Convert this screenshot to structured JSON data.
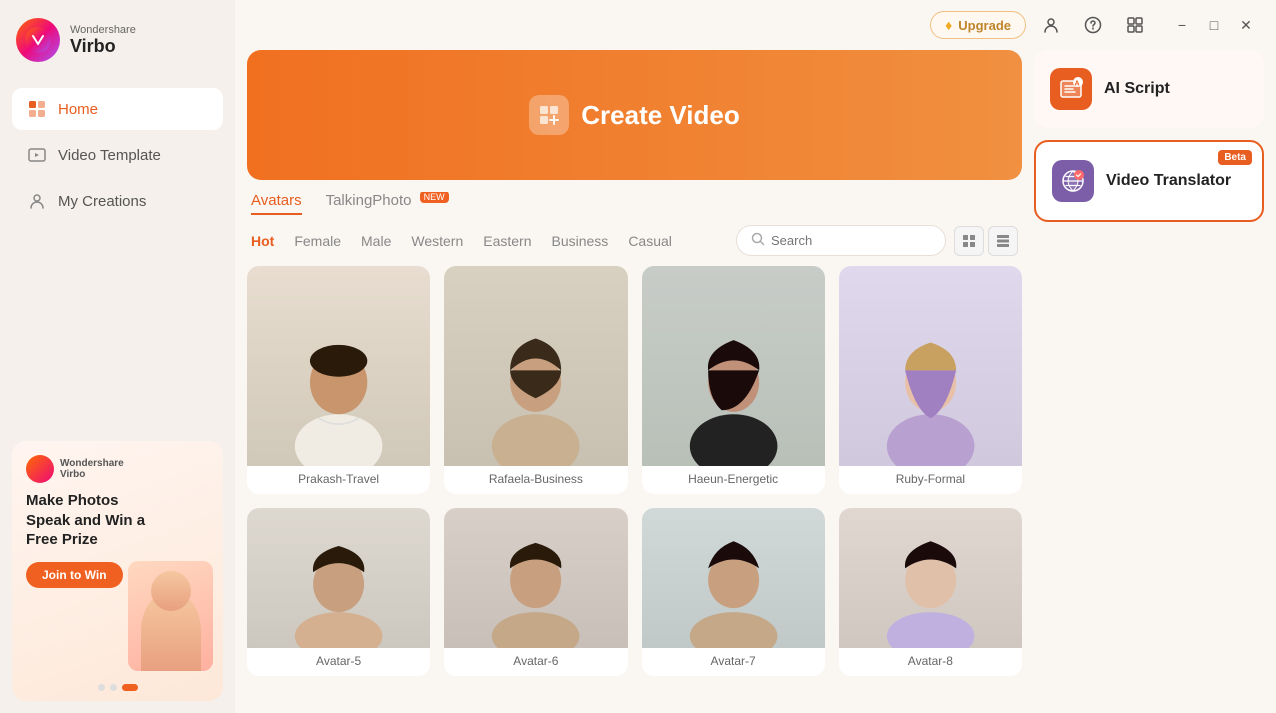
{
  "app": {
    "brand": "Wondershare",
    "product": "Virbo"
  },
  "sidebar": {
    "nav_items": [
      {
        "id": "home",
        "label": "Home",
        "active": true
      },
      {
        "id": "video-template",
        "label": "Video Template",
        "active": false
      },
      {
        "id": "my-creations",
        "label": "My Creations",
        "active": false
      }
    ]
  },
  "ad": {
    "brand": "Wondershare",
    "product": "Virbo",
    "title": "Make Photos Speak and Win a Free Prize",
    "cta": "Join to Win",
    "dots": [
      false,
      false,
      true
    ]
  },
  "topbar": {
    "upgrade_label": "Upgrade"
  },
  "create_banner": {
    "label": "Create Video"
  },
  "tabs": [
    {
      "id": "avatars",
      "label": "Avatars",
      "active": true,
      "new": false
    },
    {
      "id": "talking-photo",
      "label": "TalkingPhoto",
      "active": false,
      "new": true
    }
  ],
  "filters": [
    {
      "id": "hot",
      "label": "Hot",
      "active": true
    },
    {
      "id": "female",
      "label": "Female",
      "active": false
    },
    {
      "id": "male",
      "label": "Male",
      "active": false
    },
    {
      "id": "western",
      "label": "Western",
      "active": false
    },
    {
      "id": "eastern",
      "label": "Eastern",
      "active": false
    },
    {
      "id": "business",
      "label": "Business",
      "active": false
    },
    {
      "id": "casual",
      "label": "Casual",
      "active": false
    }
  ],
  "search": {
    "placeholder": "Search"
  },
  "avatars": [
    {
      "id": 1,
      "name": "Prakash-Travel",
      "bg": "#e8d8c8",
      "skin": "#c8956c"
    },
    {
      "id": 2,
      "name": "Rafaela-Business",
      "bg": "#d8d4c8",
      "skin": "#c8a080"
    },
    {
      "id": 3,
      "name": "Haeun-Energetic",
      "bg": "#c8d0c8",
      "skin": "#c09078"
    },
    {
      "id": 4,
      "name": "Ruby-Formal",
      "bg": "#e0d8e8",
      "skin": "#e8c0a8"
    },
    {
      "id": 5,
      "name": "Avatar-5",
      "bg": "#ddd8d0",
      "skin": "#c8a080"
    },
    {
      "id": 6,
      "name": "Avatar-6",
      "bg": "#d8d0c8",
      "skin": "#c8a080"
    },
    {
      "id": 7,
      "name": "Avatar-7",
      "bg": "#d0d8d8",
      "skin": "#c8a080"
    },
    {
      "id": 8,
      "name": "Avatar-8",
      "bg": "#e0d8d0",
      "skin": "#c8a080"
    }
  ],
  "right_panel": {
    "ai_script": {
      "label": "AI Script"
    },
    "video_translator": {
      "label": "Video Translator",
      "badge": "Beta"
    }
  }
}
